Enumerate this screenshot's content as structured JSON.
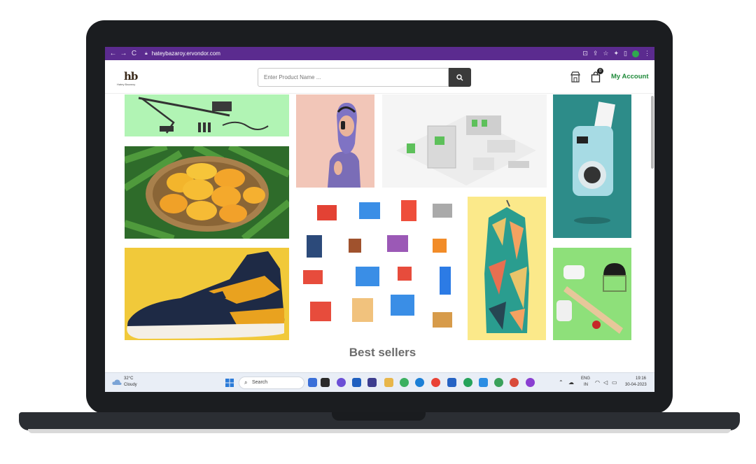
{
  "browser": {
    "url": "hateybazaroy.ervondor.com",
    "nav": {
      "back": "←",
      "forward": "→",
      "reload": "C"
    }
  },
  "header": {
    "logo_mark": "hb",
    "logo_sub": "Hatey Bazaroy",
    "search_placeholder": "Enter Product Name ...",
    "cart_count": "0",
    "account_label": "My Account"
  },
  "section": {
    "title": "Best sellers"
  },
  "taskbar": {
    "weather_temp": "32°C",
    "weather_desc": "Cloudy",
    "search_label": "Search",
    "lang": "ENG",
    "region": "IN",
    "time": "19:16",
    "date": "30-04-2023"
  },
  "colors": {
    "chrome": "#5b2b8f",
    "accent": "#1f8a3a"
  }
}
